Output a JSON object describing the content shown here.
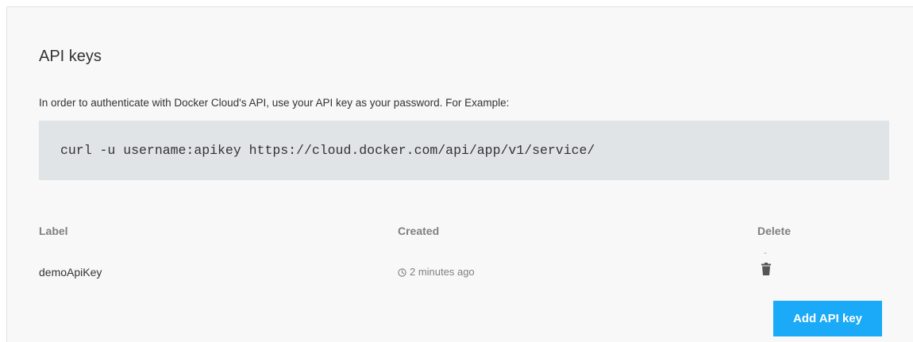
{
  "section": {
    "title": "API keys",
    "description": "In order to authenticate with Docker Cloud's API, use your API key as your password. For Example:",
    "code_example": "curl -u username:apikey https://cloud.docker.com/api/app/v1/service/"
  },
  "table": {
    "headers": {
      "label": "Label",
      "created": "Created",
      "delete": "Delete"
    },
    "rows": [
      {
        "label": "demoApiKey",
        "created": "2 minutes ago",
        "delete_marker": "-"
      }
    ]
  },
  "actions": {
    "add_label": "Add API key"
  },
  "colors": {
    "accent": "#1aaaf8",
    "panel_bg": "#f8f8f8",
    "code_bg": "#e1e4e6"
  },
  "icons": {
    "created": "clock-icon",
    "delete": "trash-icon"
  }
}
